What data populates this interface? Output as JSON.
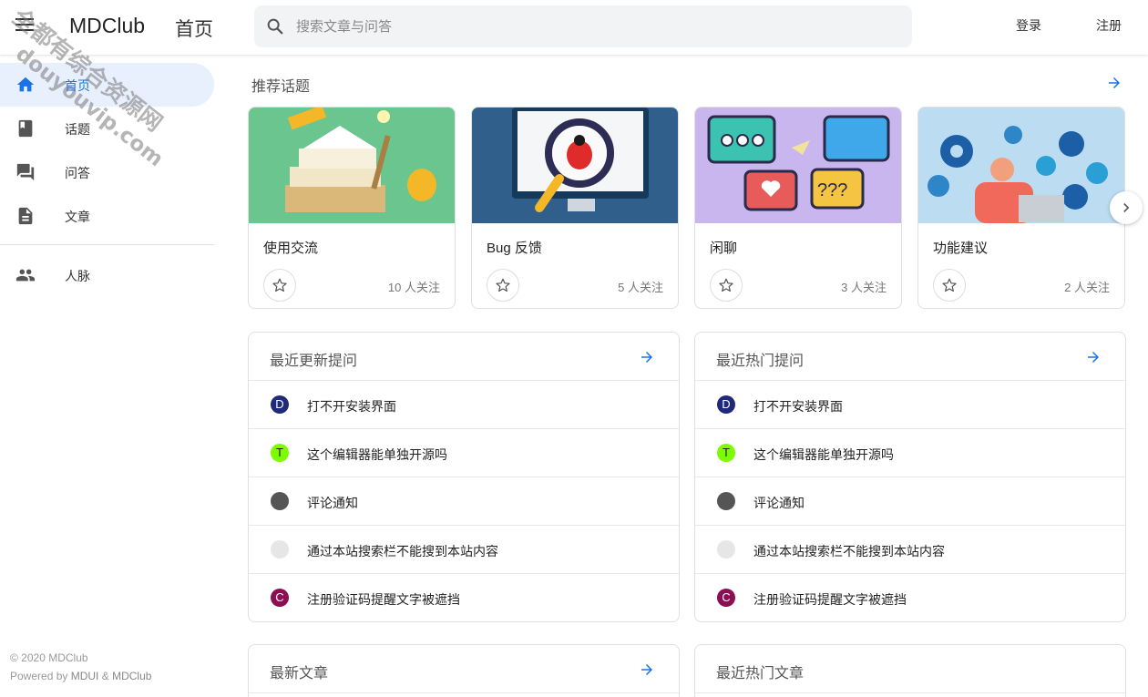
{
  "header": {
    "logo": "MDClub",
    "page_title": "首页",
    "search_placeholder": "搜索文章与问答",
    "login_label": "登录",
    "register_label": "注册"
  },
  "sidebar": {
    "items": [
      {
        "label": "首页",
        "icon": "home-icon",
        "active": true
      },
      {
        "label": "话题",
        "icon": "book-icon"
      },
      {
        "label": "问答",
        "icon": "forum-icon"
      },
      {
        "label": "文章",
        "icon": "description-icon"
      },
      {
        "label": "人脉",
        "icon": "people-icon"
      }
    ],
    "footer_copyright": "© 2020 MDClub",
    "footer_powered_prefix": "Powered by",
    "footer_mdui": "MDUI",
    "footer_and": "&",
    "footer_mdclub": "MDClub"
  },
  "watermark": {
    "line1": "全都有综合资源网",
    "line2": "douyouvip.com"
  },
  "topics": {
    "title": "推荐话题",
    "cards": [
      {
        "name": "使用交流",
        "followers": "10 人关注"
      },
      {
        "name": "Bug 反馈",
        "followers": "5 人关注"
      },
      {
        "name": "闲聊",
        "followers": "3 人关注"
      },
      {
        "name": "功能建议",
        "followers": "2 人关注"
      }
    ]
  },
  "recent_questions": {
    "title": "最近更新提问",
    "items": [
      {
        "avatar": "D",
        "color": "#1f2a7a",
        "title": "打不开安装界面"
      },
      {
        "avatar": "T",
        "color": "#7cfc00",
        "title": "这个编辑器能单独开源吗"
      },
      {
        "avatar": "",
        "color": "#555555",
        "title": "评论通知"
      },
      {
        "avatar": "",
        "color": "#e6e6e6",
        "title": "通过本站搜索栏不能搜到本站内容"
      },
      {
        "avatar": "C",
        "color": "#8b0f52",
        "title": "注册验证码提醒文字被遮挡"
      }
    ]
  },
  "hot_questions": {
    "title": "最近热门提问",
    "items": [
      {
        "avatar": "D",
        "color": "#1f2a7a",
        "title": "打不开安装界面"
      },
      {
        "avatar": "T",
        "color": "#7cfc00",
        "title": "这个编辑器能单独开源吗"
      },
      {
        "avatar": "",
        "color": "#555555",
        "title": "评论通知"
      },
      {
        "avatar": "",
        "color": "#e6e6e6",
        "title": "通过本站搜索栏不能搜到本站内容"
      },
      {
        "avatar": "C",
        "color": "#8b0f52",
        "title": "注册验证码提醒文字被遮挡"
      }
    ]
  },
  "latest_articles": {
    "title": "最新文章"
  },
  "hot_articles": {
    "title": "最近热门文章"
  },
  "colors": {
    "accent": "#1a73e8",
    "active_bg": "#e8f0fe"
  }
}
